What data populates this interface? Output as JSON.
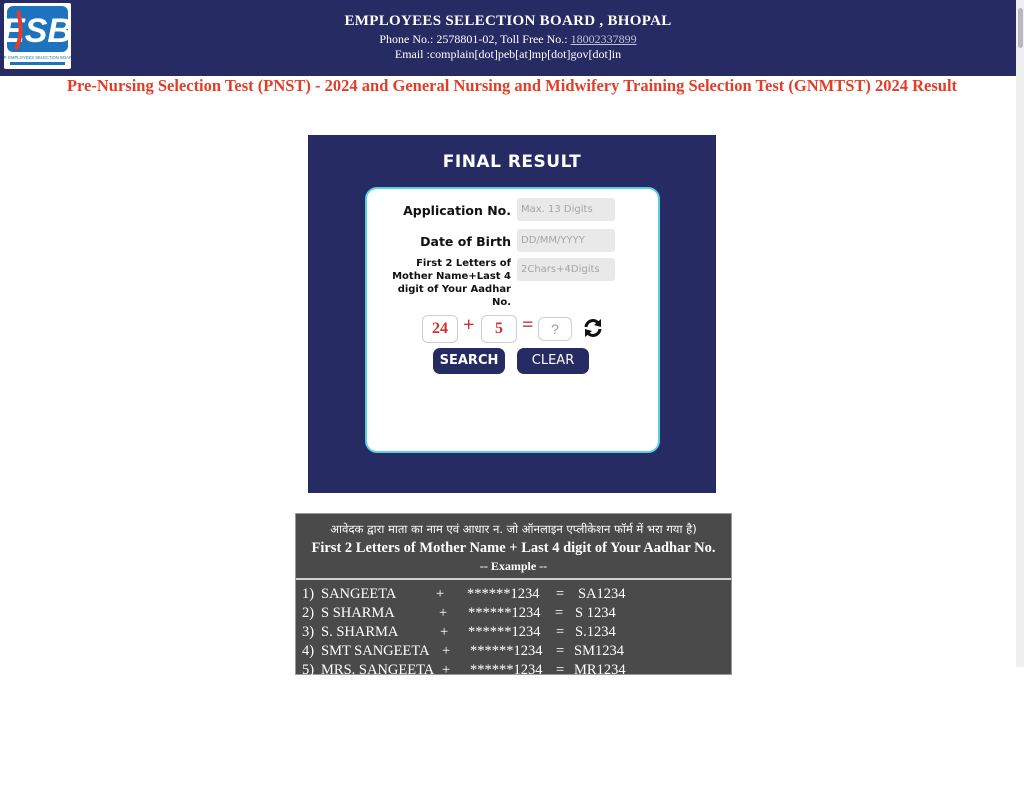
{
  "header": {
    "logo_icon": "esb-logo-icon",
    "logo_caption": "M.P. EMPLOYEES SELECTION BOARD",
    "title": "EMPLOYEES SELECTION BOARD , BHOPAL",
    "phone_prefix": "Phone No.: 2578801-02, Toll Free No.:",
    "toll_free": "18002337899",
    "email": "Email :complain[dot]peb[at]mp[dot]gov[dot]in"
  },
  "page_title": "Pre-Nursing Selection Test (PNST) - 2024 and General Nursing and Midwifery Training Selection Test (GNMTST) 2024 Result",
  "form": {
    "heading": "FINAL RESULT",
    "application_label": "Application No.",
    "application_placeholder": "Max. 13 Digits",
    "dob_label": "Date of Birth",
    "dob_placeholder": "DD/MM/YYYY",
    "mother_label": "First 2 Letters of Mother Name+Last 4 digit of Your Aadhar No.",
    "mother_placeholder": "2Chars+4Digits",
    "captcha": {
      "num1": "24",
      "operator": "+",
      "num2": "5",
      "equals": "=",
      "answer_placeholder": "?",
      "refresh_icon": "refresh-icon"
    },
    "search_label": "SEARCH",
    "clear_label": "CLEAR"
  },
  "info": {
    "hindi_note": "आवेदक द्वारा माता का नाम  एवं आधार न. जो ऑनलाइन एप्लीकेशन फॉर्म में भरा गया है)",
    "english_heading": "First 2 Letters of Mother Name + Last 4 digit of Your Aadhar No.",
    "example_label": "-- Example --",
    "examples": [
      {
        "num": "1)",
        "name": "SANGEETA",
        "plus": "+",
        "aadhar": "******1234",
        "eq": "=",
        "result": "SA1234"
      },
      {
        "num": "2)",
        "name": "S SHARMA",
        "plus": "+",
        "aadhar": "******1234",
        "eq": "=",
        "result": "S 1234"
      },
      {
        "num": "3)",
        "name": "S. SHARMA",
        "plus": "+",
        "aadhar": "******1234",
        "eq": "=",
        "result": "S.1234"
      },
      {
        "num": "4)",
        "name": "SMT SANGEETA",
        "plus": "+",
        "aadhar": "******1234",
        "eq": "=",
        "result": "SM1234"
      },
      {
        "num": "5)",
        "name": "MRS. SANGEETA",
        "plus": "+",
        "aadhar": "******1234",
        "eq": "=",
        "result": "MR1234"
      }
    ]
  },
  "colors": {
    "header_bg": "#262b63",
    "title_red": "#e23d28",
    "card_border": "#5ad0e0",
    "info_bg": "#4a4a4a"
  }
}
